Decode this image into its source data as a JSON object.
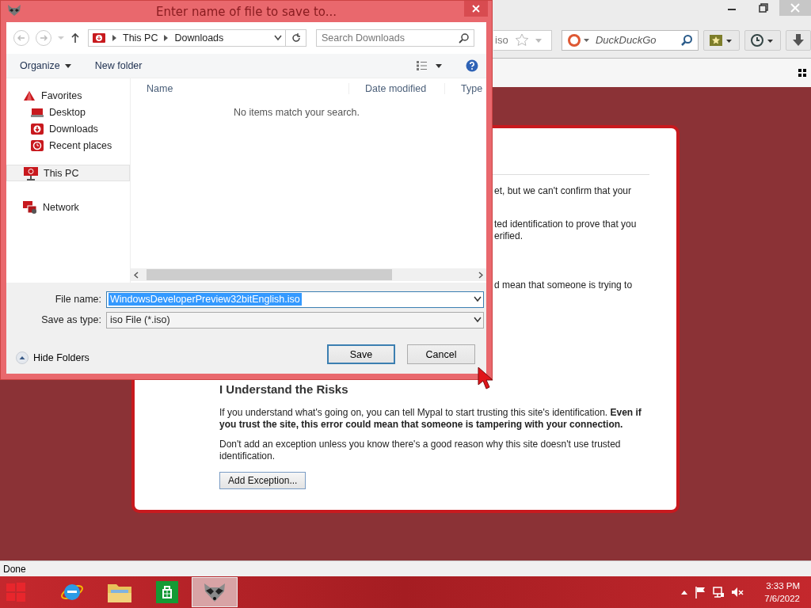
{
  "browser": {
    "address_fragment": "iso",
    "search": {
      "placeholder": "DuckDuckGo"
    },
    "status": "Done"
  },
  "error_page": {
    "fragments": [
      "et, but we can't confirm that your",
      "ted identification to prove that you",
      "erified.",
      "d mean that someone is trying to"
    ],
    "heading": "I Understand the Risks",
    "paragraphs": [
      "If you understand what's going on, you can tell Mypal to start trusting this site's identification. **Even if you trust the site, this error could mean that someone is tampering with your connection.**",
      "Don't add an exception unless you know there's a good reason why this site doesn't use trusted identification."
    ],
    "button": "Add Exception..."
  },
  "dialog": {
    "title": "Enter name of file to save to...",
    "breadcrumb": [
      "This PC",
      "Downloads"
    ],
    "search": {
      "placeholder": "Search Downloads"
    },
    "commands": [
      {
        "label": "Organize",
        "kind": "menu"
      },
      {
        "label": "New folder",
        "kind": "plain"
      }
    ],
    "columns": [
      "Name",
      "Date modified",
      "Type"
    ],
    "empty_message": "No items match your search.",
    "sidebar": [
      {
        "label": "Favorites",
        "kind": "star",
        "selected": false,
        "children": [
          {
            "label": "Desktop",
            "kind": "desktop",
            "selected": false
          },
          {
            "label": "Downloads",
            "kind": "download",
            "selected": false
          },
          {
            "label": "Recent places",
            "kind": "recent",
            "selected": false
          }
        ]
      },
      {
        "label": "This PC",
        "kind": "pc",
        "selected": true
      },
      {
        "label": "Network",
        "kind": "network",
        "selected": false
      }
    ],
    "file_name": {
      "label": "File name:",
      "value": "WindowsDeveloperPreview32bitEnglish.iso",
      "text_selected": true
    },
    "save_type": {
      "label": "Save as type:",
      "value": "iso File (*.iso)"
    },
    "hide_folders": "Hide Folders",
    "buttons": [
      {
        "label": "Save",
        "default": true
      },
      {
        "label": "Cancel",
        "default": false
      }
    ]
  },
  "taskbar": {
    "apps": [
      {
        "kind": "browser",
        "selected": false
      },
      {
        "kind": "folder",
        "selected": false
      },
      {
        "kind": "store",
        "selected": false
      },
      {
        "kind": "raccoon",
        "selected": true
      }
    ],
    "time": "3:33 PM",
    "date": "7/6/2022"
  }
}
